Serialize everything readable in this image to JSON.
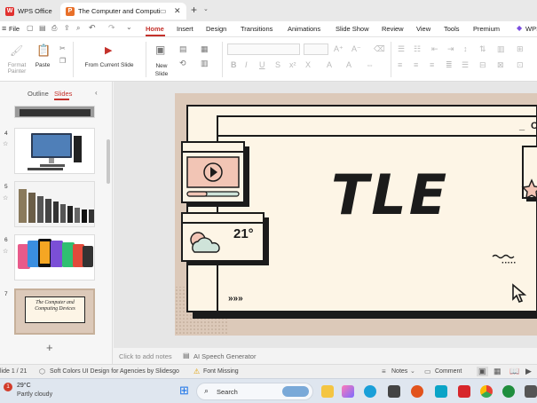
{
  "titlebar": {
    "tabs": [
      {
        "label": "WPS Office"
      },
      {
        "label": "The Computer and Computi"
      }
    ],
    "new_tab": "+"
  },
  "menu": {
    "file": "File",
    "items": [
      "Home",
      "Insert",
      "Design",
      "Transitions",
      "Animations",
      "Slide Show",
      "Review",
      "View",
      "Tools",
      "Premium",
      "WPS"
    ]
  },
  "ribbon": {
    "format_painter": "Format Painter",
    "paste": "Paste",
    "from_current_slide": "From Current Slide",
    "new_slide": "New Slide"
  },
  "left_panel": {
    "tabs": [
      "Outline",
      "Slides"
    ],
    "thumbnails": [
      {
        "number": "4"
      },
      {
        "number": "5"
      },
      {
        "number": "6"
      },
      {
        "number": "7",
        "text": "The Computer and Computing Devices"
      }
    ]
  },
  "slide": {
    "title": "TLE",
    "temperature": "21°",
    "min_label": "_",
    "corner_label": "C"
  },
  "notes": {
    "placeholder": "Click to add notes",
    "speech_generator": "AI Speech Generator"
  },
  "status": {
    "slide_counter": "lide 1 / 21",
    "theme": "Soft Colors UI Design for Agencies by Slidesgo",
    "font_missing": "Font Missing",
    "notes": "Notes",
    "comment": "Comment"
  },
  "taskbar": {
    "weather_temp": "29°C",
    "weather_desc": "Partly cloudy",
    "search": "Search",
    "weather_badge": "1"
  },
  "colors": {
    "accent": "#c4312b",
    "slide_bg": "#fdf5e6",
    "slide_outer": "#dcc9b9",
    "widget_pink": "#f2c5b5",
    "widget_mint": "#cfe3d9"
  }
}
